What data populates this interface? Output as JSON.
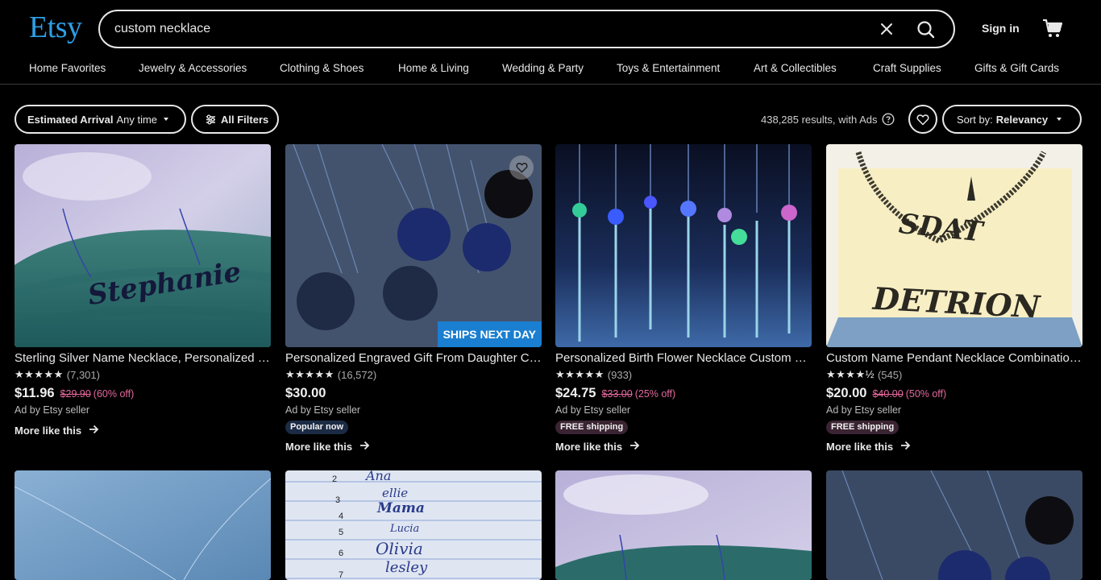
{
  "header": {
    "logo": "Etsy",
    "search_value": "custom necklace",
    "sign_in": "Sign in",
    "colors": {
      "logo": "#2e9fe6",
      "sale": "#e3689c",
      "ships_badge": "#1a7fd1"
    }
  },
  "nav": {
    "items": [
      "Home Favorites",
      "Jewelry & Accessories",
      "Clothing & Shoes",
      "Home & Living",
      "Wedding & Party",
      "Toys & Entertainment",
      "Art & Collectibles",
      "Craft Supplies",
      "Gifts & Gift Cards"
    ]
  },
  "filters": {
    "arrival_label": "Estimated Arrival",
    "arrival_value": "Any time",
    "all_filters": "All Filters",
    "results": "438,285 results, with Ads",
    "sort_label": "Sort by:",
    "sort_value": "Relevancy"
  },
  "listings": [
    {
      "title": "Sterling Silver Name Necklace, Personalized J…",
      "stars": "★★★★★",
      "reviews": "(7,301)",
      "price": "$11.96",
      "original_price": "$29.90",
      "discount": "(60% off)",
      "seller": "Ad by Etsy seller",
      "badge": "",
      "more": "More like this",
      "image_text": "Stephanie"
    },
    {
      "title": "Personalized Engraved Gift From Daughter C…",
      "stars": "★★★★★",
      "reviews": "(16,572)",
      "price": "$30.00",
      "original_price": "",
      "discount": "",
      "seller": "Ad by Etsy seller",
      "badge": "Popular now",
      "more": "More like this",
      "image_text": "SHIPS NEXT DAY"
    },
    {
      "title": "Personalized Birth Flower Necklace Custom N…",
      "stars": "★★★★★",
      "reviews": "(933)",
      "price": "$24.75",
      "original_price": "$33.00",
      "discount": "(25% off)",
      "seller": "Ad by Etsy seller",
      "badge": "FREE shipping",
      "more": "More like this"
    },
    {
      "title": "Custom Name Pendant Necklace Combinatio…",
      "stars": "★★★★½",
      "reviews": "(545)",
      "price": "$20.00",
      "original_price": "$40.00",
      "discount": "(50% off)",
      "seller": "Ad by Etsy seller",
      "badge": "FREE shipping",
      "more": "More like this",
      "image_text": [
        "SDAT",
        "DETRION"
      ]
    }
  ],
  "row2_image_text": [
    "2",
    "3",
    "4",
    "5",
    "6",
    "7",
    "Ana",
    "ellie",
    "Mama",
    "Lucia",
    "Olivia",
    "lesley"
  ]
}
